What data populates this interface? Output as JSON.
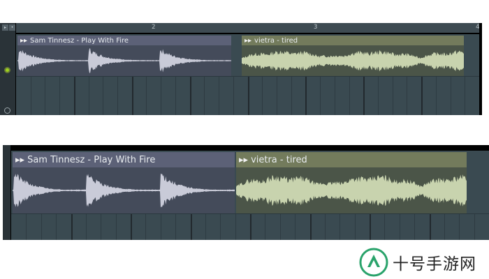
{
  "ruler": {
    "markers": [
      "2",
      "3",
      "4"
    ]
  },
  "top_panel": {
    "clip_a_title": "Sam Tinnesz - Play With Fire",
    "clip_b_title": "vietra - tired"
  },
  "bottom_panel": {
    "clip_a_title": "Sam Tinnesz - Play With Fire",
    "clip_b_title": "vietra - tired"
  },
  "watermark": {
    "text": "十号手游网"
  },
  "colors": {
    "clip_a_header": "#5c6177",
    "clip_b_header": "#737b5c",
    "wave_a": "#c9cbd8",
    "wave_b": "#c8d3ae",
    "track_bg": "#3a4a51",
    "active_indicator": "#9dd21f",
    "logo_green": "#2aa36b"
  },
  "icons": [
    "play-icon",
    "toggle-icon",
    "mute-indicator-icon",
    "record-indicator-icon",
    "site-logo-icon"
  ]
}
